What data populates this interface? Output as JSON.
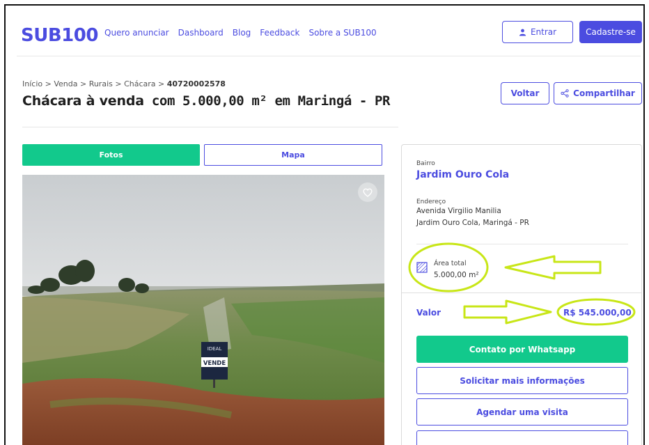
{
  "header": {
    "logo_text": "SUB100",
    "nav": [
      "Quero anunciar",
      "Dashboard",
      "Blog",
      "Feedback",
      "Sobre a SUB100"
    ],
    "login_label": "Entrar",
    "signup_label": "Cadastre-se"
  },
  "breadcrumb": {
    "items": [
      "Início",
      "Venda",
      "Rurais",
      "Chácara"
    ],
    "separator": " > ",
    "current": "40720002578"
  },
  "title": {
    "strong": "Chácara à venda",
    "rest": " com 5.000,00 m² em Maringá - PR"
  },
  "actions": {
    "back_label": "Voltar",
    "share_label": "Compartilhar"
  },
  "tabs": {
    "photos": "Fotos",
    "map": "Mapa"
  },
  "photo": {
    "sign_brand": "IDEAL",
    "sign_text": "VENDE"
  },
  "details": {
    "bairro_label": "Bairro",
    "bairro": "Jardim Ouro Cola",
    "endereco_label": "Endereço",
    "endereco_line1": "Avenida Virgilio Manilia",
    "endereco_line2": "Jardim Ouro Cola, Maringá - PR",
    "area_label": "Área total",
    "area_value": "5.000,00 m²",
    "valor_label": "Valor",
    "valor": "R$ 545.000,00"
  },
  "buttons": {
    "whatsapp": "Contato por Whatsapp",
    "info": "Solicitar mais informações",
    "visit": "Agendar uma visita"
  },
  "colors": {
    "brand": "#4b4ce0",
    "green": "#12c98c",
    "annotation": "#c8e617"
  },
  "icons": {
    "login": "user-icon",
    "share": "share-icon",
    "favorite": "heart-icon",
    "area": "area-icon"
  }
}
